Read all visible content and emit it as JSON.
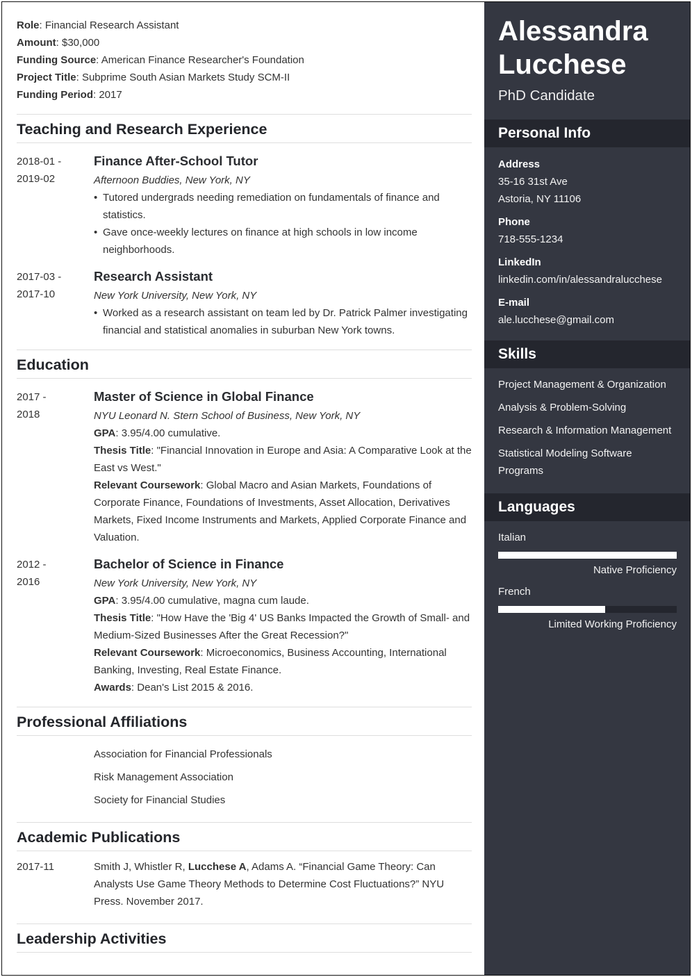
{
  "funding": [
    {
      "label": "Role",
      "value": "Financial Research Assistant"
    },
    {
      "label": "Amount",
      "value": "$30,000"
    },
    {
      "label": "Funding Source",
      "value": "American Finance Researcher's Foundation"
    },
    {
      "label": "Project Title",
      "value": "Subprime South Asian Markets Study SCM-II"
    },
    {
      "label": "Funding Period",
      "value": "2017"
    }
  ],
  "experience": {
    "heading": "Teaching and Research Experience",
    "items": [
      {
        "date_start": "2018-01 -",
        "date_end": "2019-02",
        "title": "Finance After-School Tutor",
        "place": "Afternoon Buddies, New York, NY",
        "bullets": [
          "Tutored undergrads needing remediation on fundamentals of finance and statistics.",
          "Gave once-weekly lectures on finance at high schools in low income neighborhoods."
        ]
      },
      {
        "date_start": "2017-03 -",
        "date_end": "2017-10",
        "title": "Research Assistant",
        "place": "New York University, New York, NY",
        "bullets": [
          "Worked as a research assistant on team led by Dr. Patrick Palmer investigating financial and statistical anomalies in suburban New York towns."
        ]
      }
    ]
  },
  "education": {
    "heading": "Education",
    "items": [
      {
        "date_start": "2017 -",
        "date_end": "2018",
        "title": "Master of Science in Global Finance",
        "place": "NYU Leonard N. Stern School of Business, New York, NY",
        "details": [
          {
            "label": "GPA",
            "value": "3.95/4.00 cumulative."
          },
          {
            "label": "Thesis Title",
            "value": "\"Financial Innovation in Europe and Asia: A Comparative Look at the East vs West.\""
          },
          {
            "label": "Relevant Coursework",
            "value": "Global Macro and Asian Markets, Foundations of Corporate Finance, Foundations of Investments, Asset Allocation, Derivatives Markets, Fixed Income Instruments and Markets, Applied Corporate Finance and Valuation."
          }
        ]
      },
      {
        "date_start": "2012 -",
        "date_end": "2016",
        "title": "Bachelor of Science in Finance",
        "place": "New York University, New York, NY",
        "details": [
          {
            "label": "GPA",
            "value": "3.95/4.00 cumulative, magna cum laude."
          },
          {
            "label": "Thesis Title",
            "value": "\"How Have the 'Big 4' US Banks Impacted the Growth of Small- and Medium-Sized Businesses After the Great Recession?\""
          },
          {
            "label": "Relevant Coursework",
            "value": "Microeconomics, Business Accounting, International Banking, Investing, Real Estate Finance."
          },
          {
            "label": "Awards",
            "value": "Dean's List 2015 & 2016."
          }
        ]
      }
    ]
  },
  "affiliations": {
    "heading": "Professional Affiliations",
    "items": [
      "Association for Financial Professionals",
      "Risk Management Association",
      "Society for Financial Studies"
    ]
  },
  "publications": {
    "heading": "Academic Publications",
    "items": [
      {
        "date": "2017-11",
        "before": "Smith J, Whistler R, ",
        "bold": "Lucchese A",
        "after": ", Adams A. “Financial Game Theory: Can Analysts Use Game Theory Methods to Determine Cost Fluctuations?” NYU Press. November 2017."
      }
    ]
  },
  "leadership": {
    "heading": "Leadership Activities"
  },
  "sidebar": {
    "name_first": "Alessandra",
    "name_last": "Lucchese",
    "subtitle": "PhD Candidate",
    "personal_heading": "Personal Info",
    "address_label": "Address",
    "address_line1": "35-16 31st Ave",
    "address_line2": "Astoria, NY 11106",
    "phone_label": "Phone",
    "phone": "718-555-1234",
    "linkedin_label": "LinkedIn",
    "linkedin": "linkedin.com/in/alessandralucchese",
    "email_label": "E-mail",
    "email": "ale.lucchese@gmail.com",
    "skills_heading": "Skills",
    "skills": [
      "Project Management & Organization",
      "Analysis & Problem-Solving",
      "Research & Information Management",
      "Statistical Modeling Software Programs"
    ],
    "languages_heading": "Languages",
    "languages": [
      {
        "name": "Italian",
        "level": "Native Proficiency",
        "proficiency": 1.0
      },
      {
        "name": "French",
        "level": "Limited Working Proficiency",
        "proficiency": 0.6
      }
    ]
  },
  "colors": {
    "sidebar_bg": "#343741",
    "sidebar_header_bg": "#24262e",
    "text": "#333333",
    "heading_text": "#24262b"
  }
}
